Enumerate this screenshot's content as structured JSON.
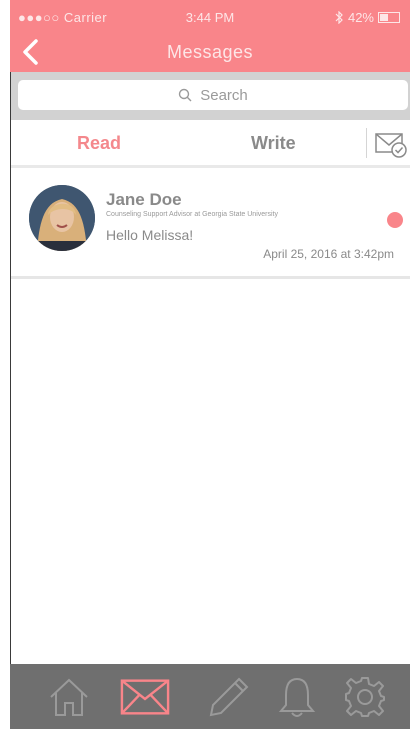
{
  "status_bar": {
    "signal": "●●●○○ Carrier",
    "time": "3:44 PM",
    "battery": "42%"
  },
  "header": {
    "title": "Messages"
  },
  "search": {
    "placeholder": "Search"
  },
  "tabs": {
    "read": "Read",
    "write": "Write"
  },
  "messages": [
    {
      "sender": "Jane Doe",
      "role": "Counseling Support Advisor at Georgia State University",
      "preview": "Hello Melissa!",
      "timestamp": "April 25, 2016 at 3:42pm",
      "unread": true
    }
  ],
  "colors": {
    "accent": "#f9858a",
    "tab_active": "#f4888c",
    "tabbar_bg": "#6f6f6f",
    "tabbar_icon": "#9a9a9a"
  },
  "icons": {
    "back": "chevron-left-icon",
    "search": "search-icon",
    "compose_read": "envelope-check-icon",
    "home": "home-icon",
    "mail": "mail-icon",
    "pen": "pencil-icon",
    "bell": "bell-icon",
    "gear": "gear-icon"
  }
}
